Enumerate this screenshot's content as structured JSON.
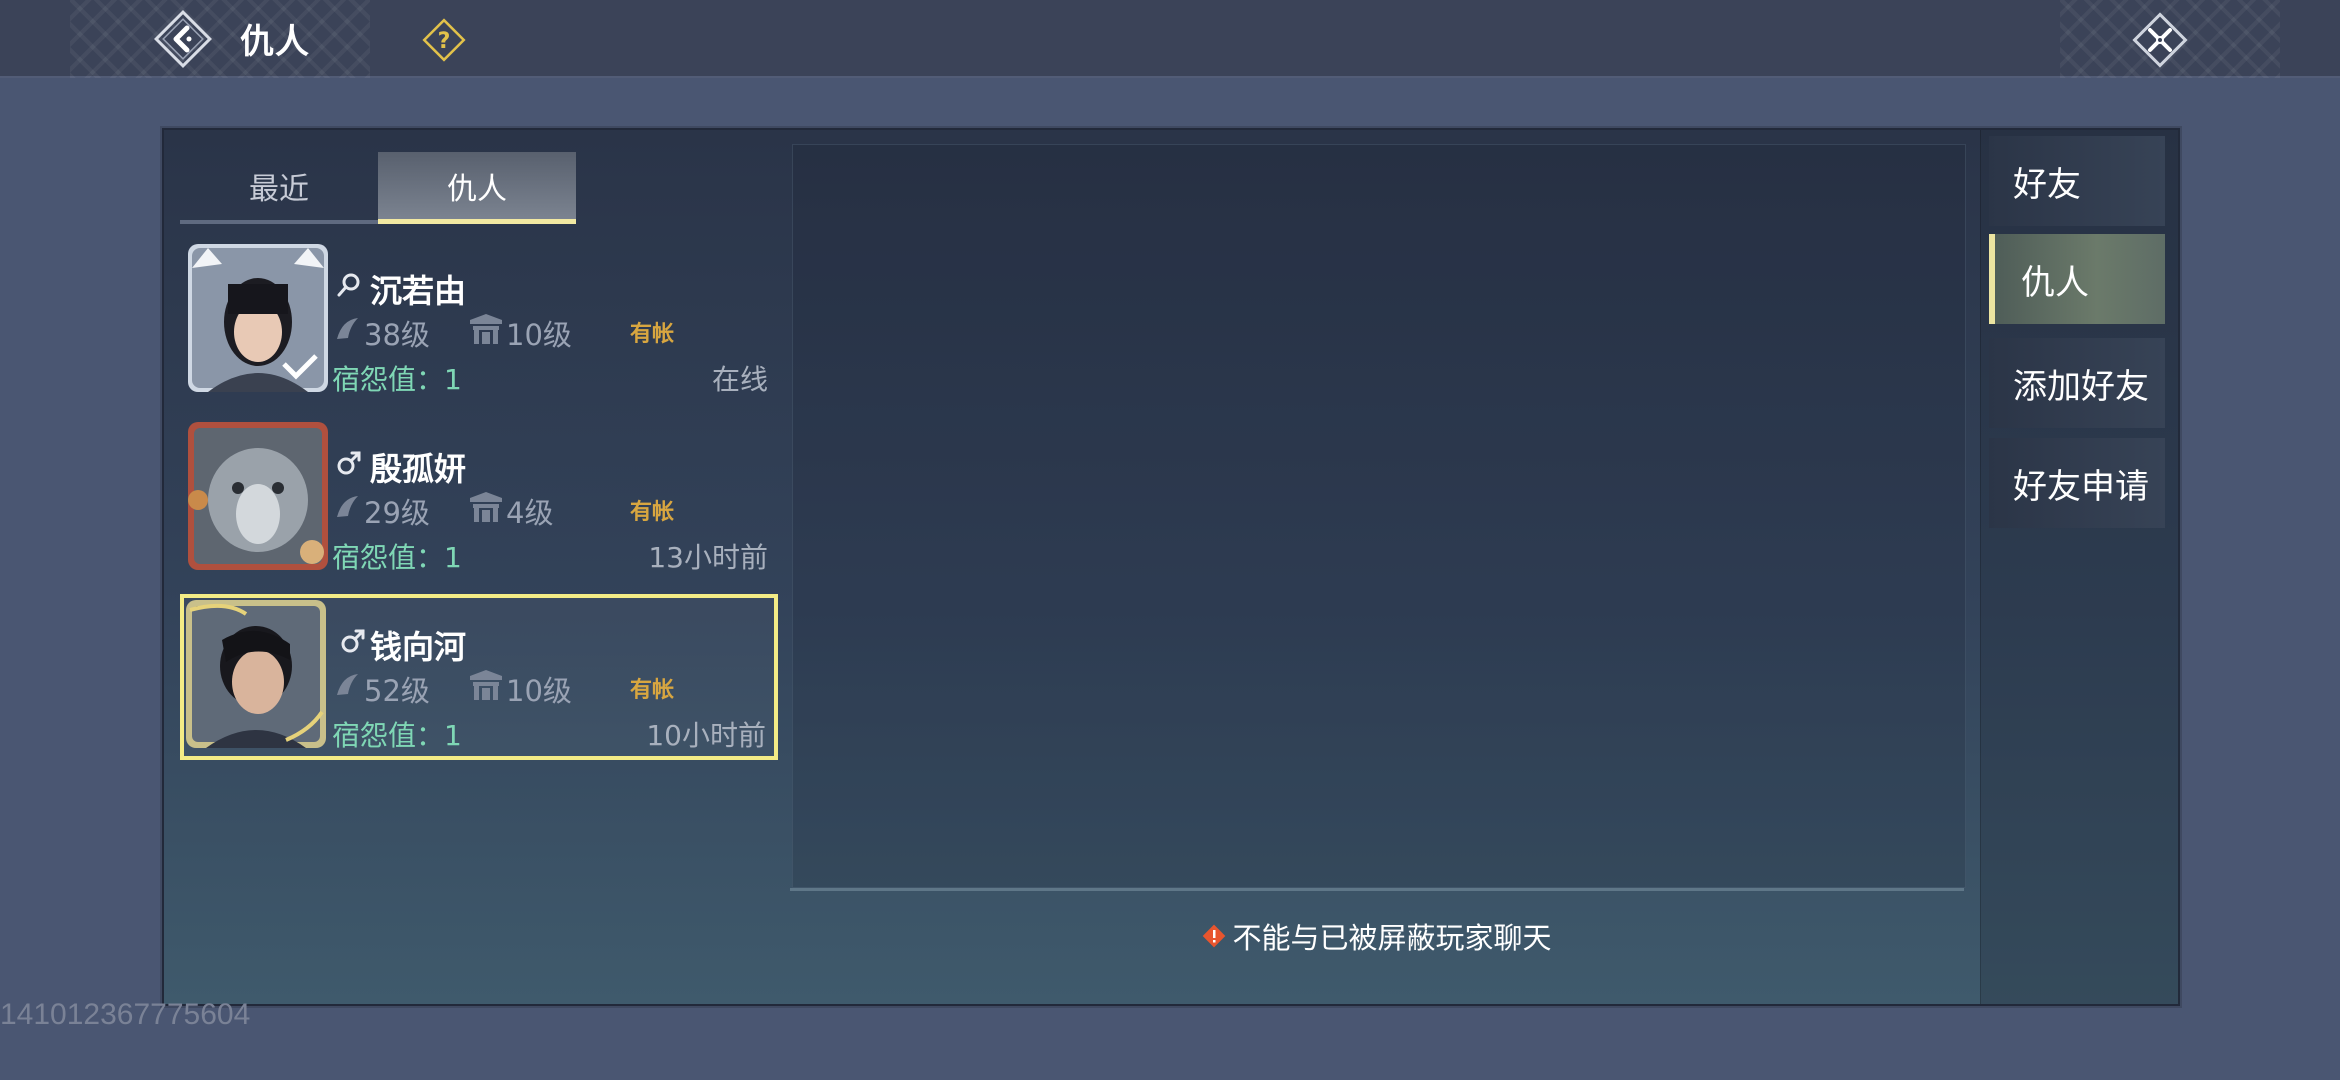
{
  "header": {
    "title": "仇人"
  },
  "left_tabs": [
    {
      "label": "最近",
      "active": false
    },
    {
      "label": "仇人",
      "active": true
    }
  ],
  "enemies": [
    {
      "name": "沉若由",
      "gender_icon": "female-icon",
      "level": "38级",
      "guild_level": "10级",
      "tag": "有帐",
      "grudge": "宿怨值：1",
      "status": "在线",
      "selected": false
    },
    {
      "name": "殷孤妍",
      "gender_icon": "male-icon",
      "level": "29级",
      "guild_level": "4级",
      "tag": "有帐",
      "grudge": "宿怨值：1",
      "status": "13小时前",
      "selected": false
    },
    {
      "name": "钱向河",
      "gender_icon": "male-icon",
      "level": "52级",
      "guild_level": "10级",
      "tag": "有帐",
      "grudge": "宿怨值：1",
      "status": "10小时前",
      "selected": true
    }
  ],
  "chat": {
    "notice": "不能与已被屏蔽玩家聊天"
  },
  "right_nav": [
    {
      "label": "好友",
      "active": false
    },
    {
      "label": "仇人",
      "active": true
    },
    {
      "label": "添加好友",
      "active": false
    },
    {
      "label": "好友申请",
      "active": false
    }
  ],
  "watermark": "141012367775604",
  "colors": {
    "accent_yellow": "#f4ec86",
    "grudge_green": "#7fd7b5",
    "tag_gold": "#d8a640"
  }
}
